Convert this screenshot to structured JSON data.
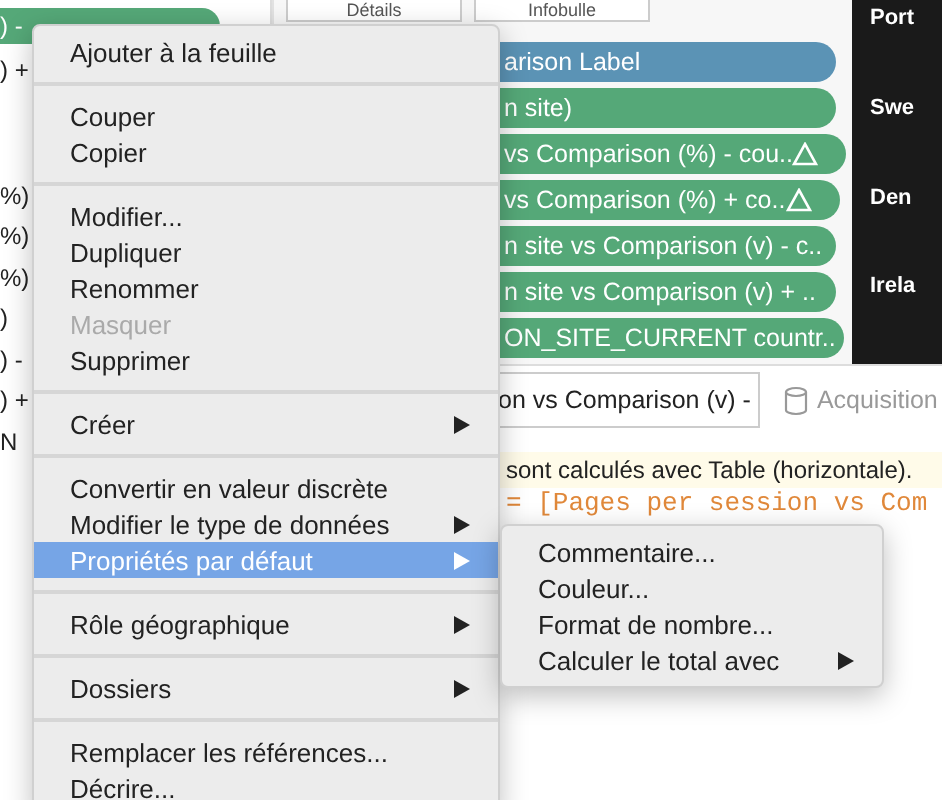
{
  "left_panel": {
    "fragments": [
      {
        "text": ") -",
        "kind": "pill"
      },
      {
        "text": ") +",
        "kind": "plain"
      },
      {
        "text": "%)",
        "kind": "plain"
      },
      {
        "text": "%)",
        "kind": "plain"
      },
      {
        "text": "%)",
        "kind": "plain"
      },
      {
        "text": ")",
        "kind": "plain"
      },
      {
        "text": ") -",
        "kind": "plain"
      },
      {
        "text": ") +",
        "kind": "plain"
      },
      {
        "text": "N",
        "kind": "plain"
      }
    ]
  },
  "shelf": {
    "buttons": [
      "Détails",
      "Infobulle"
    ],
    "pills": [
      {
        "text": "arison Label",
        "color": "#5b93b5",
        "warning": false
      },
      {
        "text": "n site)",
        "color": "#55a878",
        "warning": false
      },
      {
        "text": "vs Comparison (%) - cou..",
        "color": "#55a878",
        "warning": true
      },
      {
        "text": "vs Comparison (%) + co..",
        "color": "#55a878",
        "warning": true
      },
      {
        "text": "n site vs Comparison (v) - c..",
        "color": "#55a878",
        "warning": false
      },
      {
        "text": "n site vs Comparison (v) + ..",
        "color": "#55a878",
        "warning": false
      },
      {
        "text": "ON_SITE_CURRENT countr..",
        "color": "#55a878",
        "warning": false
      }
    ]
  },
  "view": {
    "row_labels": [
      "Port",
      "Swe",
      "Den",
      "Irela"
    ]
  },
  "calc_editor": {
    "name_field": "on vs Comparison (v) -",
    "data_source": {
      "label": "Acquisition",
      "disabled": true
    },
    "note": "sont calculés avec Table (horizontale).",
    "formula": "= [Pages per session vs Com"
  },
  "context_menu": {
    "groups": [
      [
        {
          "label": "Ajouter à la feuille",
          "disabled": false,
          "submenu": false,
          "selected": false
        }
      ],
      [
        {
          "label": "Couper",
          "disabled": false,
          "submenu": false,
          "selected": false
        },
        {
          "label": "Copier",
          "disabled": false,
          "submenu": false,
          "selected": false
        }
      ],
      [
        {
          "label": "Modifier...",
          "disabled": false,
          "submenu": false,
          "selected": false
        },
        {
          "label": "Dupliquer",
          "disabled": false,
          "submenu": false,
          "selected": false
        },
        {
          "label": "Renommer",
          "disabled": false,
          "submenu": false,
          "selected": false
        },
        {
          "label": "Masquer",
          "disabled": true,
          "submenu": false,
          "selected": false
        },
        {
          "label": "Supprimer",
          "disabled": false,
          "submenu": false,
          "selected": false
        }
      ],
      [
        {
          "label": "Créer",
          "disabled": false,
          "submenu": true,
          "selected": false
        }
      ],
      [
        {
          "label": "Convertir en valeur discrète",
          "disabled": false,
          "submenu": false,
          "selected": false
        },
        {
          "label": "Modifier le type de données",
          "disabled": false,
          "submenu": true,
          "selected": false
        },
        {
          "label": "Propriétés par défaut",
          "disabled": false,
          "submenu": true,
          "selected": true
        }
      ],
      [
        {
          "label": "Rôle géographique",
          "disabled": false,
          "submenu": true,
          "selected": false
        }
      ],
      [
        {
          "label": "Dossiers",
          "disabled": false,
          "submenu": true,
          "selected": false
        }
      ],
      [
        {
          "label": "Remplacer les références...",
          "disabled": false,
          "submenu": false,
          "selected": false
        },
        {
          "label": "Décrire...",
          "disabled": false,
          "submenu": false,
          "selected": false
        }
      ]
    ]
  },
  "submenu": {
    "items": [
      {
        "label": "Commentaire...",
        "submenu": false
      },
      {
        "label": "Couleur...",
        "submenu": false
      },
      {
        "label": "Format de nombre...",
        "submenu": false
      },
      {
        "label": "Calculer le total avec",
        "submenu": true
      }
    ]
  }
}
